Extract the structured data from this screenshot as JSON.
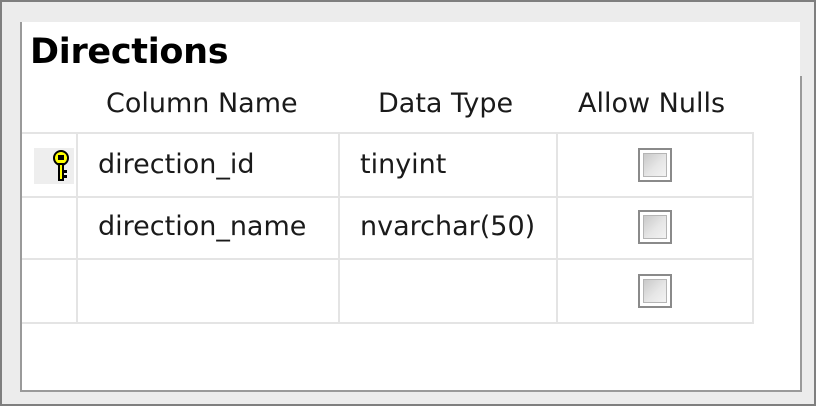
{
  "table": {
    "title": "Directions"
  },
  "columns": {
    "name_header": "Column Name",
    "type_header": "Data Type",
    "null_header": "Allow Nulls"
  },
  "rows": [
    {
      "name": "direction_id",
      "type": "tinyint",
      "allow_nulls": false,
      "primary_key": true,
      "key_icon": "primary-key-icon"
    },
    {
      "name": "direction_name",
      "type": "nvarchar(50)",
      "allow_nulls": false,
      "primary_key": false
    },
    {
      "name": "",
      "type": "",
      "allow_nulls": false,
      "primary_key": false
    }
  ],
  "colors": {
    "key_icon": "#ffff00",
    "border": "#9a9a9a",
    "gridline": "#e4e4e4"
  }
}
